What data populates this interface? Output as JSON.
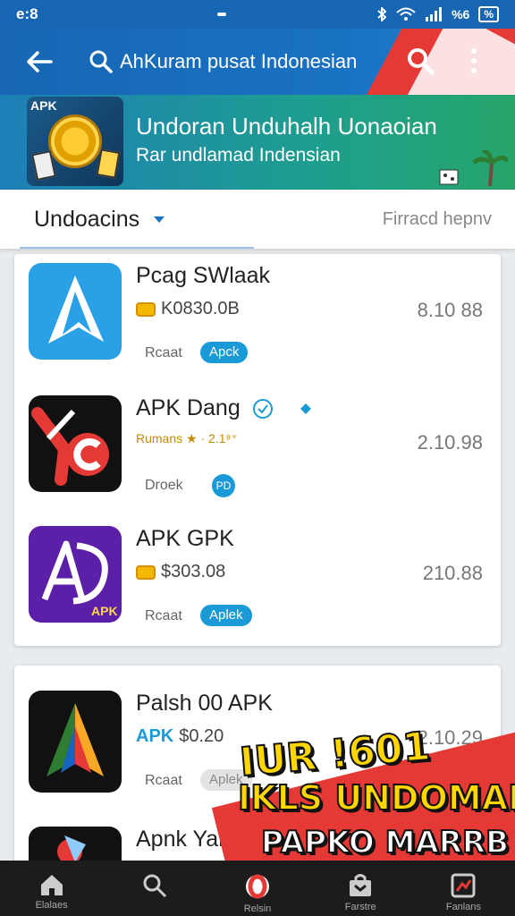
{
  "status_bar": {
    "time": "e:8",
    "battery": "%",
    "signal_text": "%6"
  },
  "app_bar": {
    "title": "AhKuram pusat Indonesian"
  },
  "banner": {
    "title": "Undoran Unduhalh Uonaoian",
    "subtitle": "Rar undlamad Indensian",
    "art_label": "APK"
  },
  "filter": {
    "sort_label": "Undoacins",
    "filter_link": "Firracd hepnv"
  },
  "apps": [
    {
      "name": "Pcag SWlaak",
      "meta": "K0830.0B",
      "label": "Rcaat",
      "badge": "Apck",
      "version": "8.10 88"
    },
    {
      "name": "APK Dang",
      "meta": "Rumans ★ · 2.1⁸⁺",
      "label": "Droek",
      "badge": "PD",
      "version": "2.10.98"
    },
    {
      "name": "APK GPK",
      "meta": "$303.08",
      "label": "Rcaat",
      "badge": "Aplek",
      "version": "210.88"
    },
    {
      "name": "Palsh 00 APK",
      "meta_prefix": "APK",
      "meta": "$0.20",
      "label": "Rcaat",
      "badge": "Aplek",
      "version": "2.10.29"
    },
    {
      "name": "Apnk Yaru"
    }
  ],
  "promo": {
    "line1": "IUR !601",
    "line2": "IKLS UNDOMAN",
    "line3": "PAPKO MARRB"
  },
  "nav": [
    {
      "icon": "home-icon",
      "label": "Elalaes"
    },
    {
      "icon": "search-icon",
      "label": ""
    },
    {
      "icon": "opera-icon",
      "label": "Relsin"
    },
    {
      "icon": "bag-icon",
      "label": "Farstre"
    },
    {
      "icon": "chart-icon",
      "label": "Fanlans"
    }
  ],
  "colors": {
    "primary": "#1a73c4",
    "accent_red": "#e53935",
    "badge_blue": "#1a9bd7"
  }
}
